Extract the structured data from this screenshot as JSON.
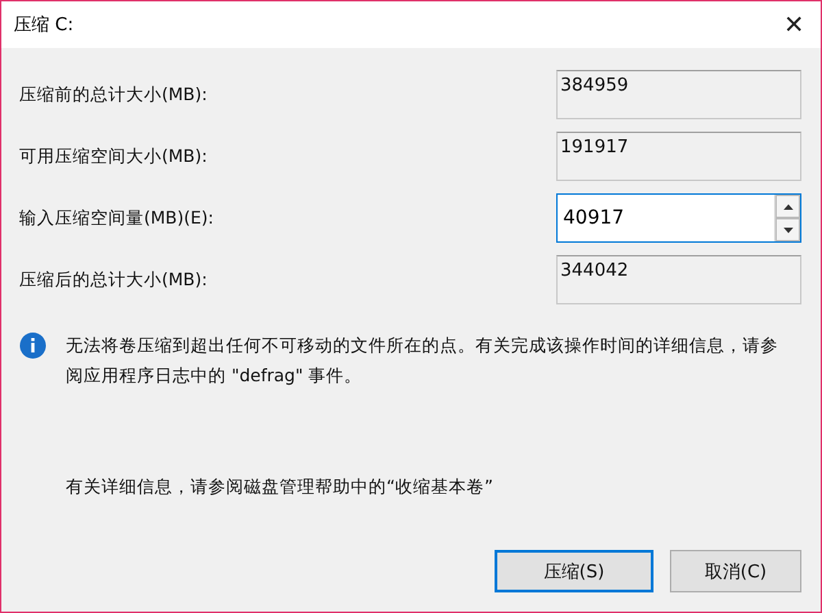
{
  "window": {
    "title": "压缩 C:",
    "close": "✕"
  },
  "fields": [
    {
      "kind": "readonly",
      "label": "压缩前的总计大小(MB):",
      "value": "384959"
    },
    {
      "kind": "readonly",
      "label": "可用压缩空间大小(MB):",
      "value": "191917"
    },
    {
      "kind": "spin",
      "label": "输入压缩空间量(MB)(E):",
      "value": "40917",
      "focused": true
    },
    {
      "kind": "readonly",
      "label": "压缩后的总计大小(MB):",
      "value": "344042"
    }
  ],
  "info": "无法将卷压缩到超出任何不可移动的文件所在的点。有关完成该操作时间的详细信息，请参阅应用程序日志中的 \"defrag\" 事件。",
  "help": "有关详细信息，请参阅磁盘管理帮助中的“收缩基本卷”",
  "buttons": [
    {
      "label": "压缩(S)",
      "default": true
    },
    {
      "label": "取消(C)",
      "default": false
    }
  ]
}
